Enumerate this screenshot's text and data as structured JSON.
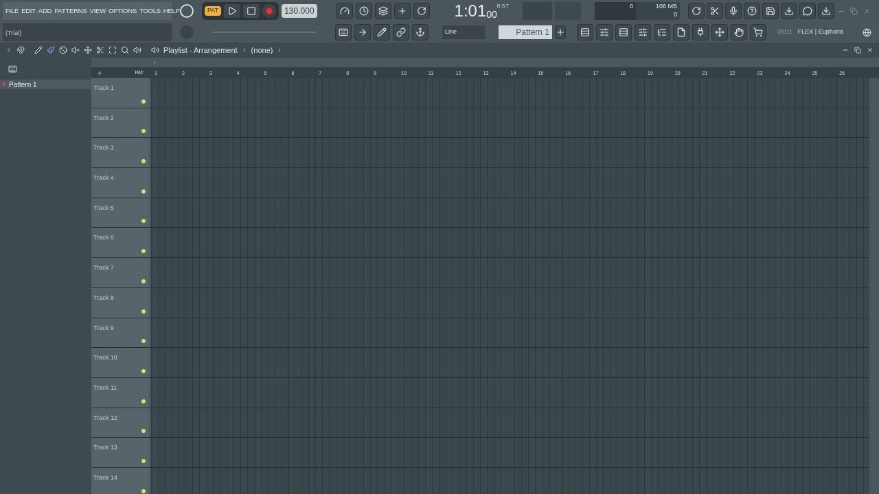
{
  "menu": [
    "FILE",
    "EDIT",
    "ADD",
    "PATTERNS",
    "VIEW",
    "OPTIONS",
    "TOOLS",
    "HELP"
  ],
  "hint": "(Trial)",
  "transport": {
    "mode": "PAT",
    "tempo": "130.000",
    "time": "1:01",
    "time_small": "00",
    "time_label": "B:S:T"
  },
  "monitor": {
    "cpu": "0",
    "memory": "106 MB",
    "polyphony": "0"
  },
  "snap": "Line",
  "pattern": "Pattern 1",
  "news": {
    "counter": "09/11",
    "text": "FLEX | Euphoria"
  },
  "picker": [
    {
      "name": "Pattern 1",
      "selected": true
    }
  ],
  "playlist": {
    "title": "Playlist - Arrangement",
    "arrangement": "(none)",
    "pat_label": "PAT",
    "bars": [
      "1",
      "2",
      "3",
      "4",
      "5",
      "6",
      "7",
      "8",
      "9",
      "10",
      "11",
      "12",
      "13",
      "14",
      "15",
      "16",
      "17",
      "18",
      "19",
      "20",
      "21",
      "22",
      "23",
      "24",
      "25",
      "26"
    ],
    "tracks": [
      {
        "name": "Track 1"
      },
      {
        "name": "Track 2"
      },
      {
        "name": "Track 3"
      },
      {
        "name": "Track 4"
      },
      {
        "name": "Track 5"
      },
      {
        "name": "Track 6"
      },
      {
        "name": "Track 7"
      },
      {
        "name": "Track 8"
      },
      {
        "name": "Track 9"
      },
      {
        "name": "Track 10"
      },
      {
        "name": "Track 11"
      },
      {
        "name": "Track 12"
      },
      {
        "name": "Track 13"
      },
      {
        "name": "Track 14"
      }
    ]
  }
}
